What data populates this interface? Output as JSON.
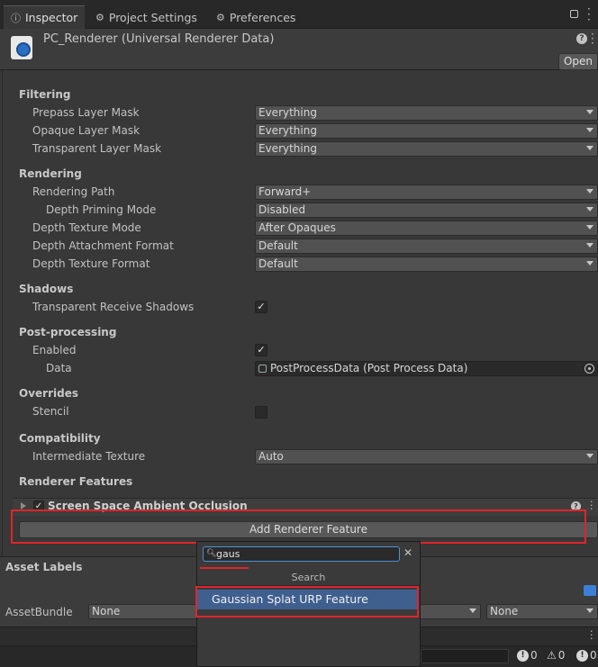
{
  "tabs": [
    {
      "label": "Inspector",
      "icon": "info-icon"
    },
    {
      "label": "Project Settings",
      "icon": "gear-icon"
    },
    {
      "label": "Preferences",
      "icon": "gear-icon"
    }
  ],
  "header": {
    "title": "PC_Renderer (Universal Renderer Data)",
    "open_label": "Open"
  },
  "filtering": {
    "section": "Filtering",
    "prepass_label": "Prepass Layer Mask",
    "prepass_value": "Everything",
    "opaque_label": "Opaque Layer Mask",
    "opaque_value": "Everything",
    "transparent_label": "Transparent Layer Mask",
    "transparent_value": "Everything"
  },
  "rendering": {
    "section": "Rendering",
    "path_label": "Rendering Path",
    "path_value": "Forward+",
    "priming_label": "Depth Priming Mode",
    "priming_value": "Disabled",
    "texmode_label": "Depth Texture Mode",
    "texmode_value": "After Opaques",
    "attach_label": "Depth Attachment Format",
    "attach_value": "Default",
    "texfmt_label": "Depth Texture Format",
    "texfmt_value": "Default"
  },
  "shadows": {
    "section": "Shadows",
    "receive_label": "Transparent Receive Shadows",
    "receive_checked": true
  },
  "postprocessing": {
    "section": "Post-processing",
    "enabled_label": "Enabled",
    "enabled_checked": true,
    "data_label": "Data",
    "data_value": "PostProcessData (Post Process Data)"
  },
  "overrides": {
    "section": "Overrides",
    "stencil_label": "Stencil",
    "stencil_checked": false
  },
  "compatibility": {
    "section": "Compatibility",
    "intermediate_label": "Intermediate Texture",
    "intermediate_value": "Auto"
  },
  "features": {
    "section": "Renderer Features",
    "items": [
      {
        "label": "Screen Space Ambient Occlusion",
        "checked": true
      }
    ],
    "add_label": "Add Renderer Feature"
  },
  "asset_labels": {
    "section": "Asset Labels",
    "bundle_label": "AssetBundle",
    "bundle_value": "None",
    "variant_value": "None"
  },
  "popup": {
    "search_value": "gaus",
    "header": "Search",
    "result": "Gaussian Splat URP Feature"
  },
  "statusbar": {
    "errors": "0",
    "warnings": "0",
    "infos": "0"
  },
  "colors": {
    "highlight": "#e0242c",
    "selection": "#3f5f8f",
    "background": "#383838"
  }
}
